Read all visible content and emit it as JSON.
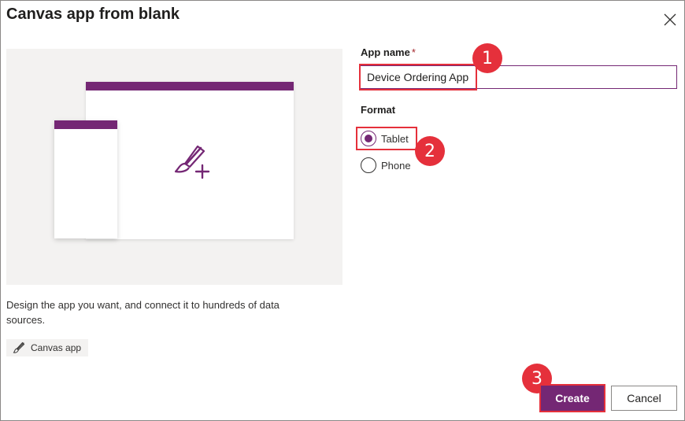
{
  "dialog": {
    "title": "Canvas app from blank",
    "close_icon": "close-icon"
  },
  "illustration": {
    "icon": "brush-plus-icon",
    "accent_color": "#742774"
  },
  "description": "Design the app you want, and connect it to hundreds of data sources.",
  "chip": {
    "icon": "paintbrush-icon",
    "label": "Canvas app"
  },
  "form": {
    "app_name_label": "App name",
    "required_marker": "*",
    "app_name_value": "Device Ordering App",
    "format_label": "Format",
    "format_options": [
      {
        "label": "Tablet",
        "selected": true
      },
      {
        "label": "Phone",
        "selected": false
      }
    ]
  },
  "callouts": [
    "1",
    "2",
    "3"
  ],
  "buttons": {
    "create": "Create",
    "cancel": "Cancel"
  },
  "colors": {
    "primary": "#742774",
    "highlight": "#e5303b"
  }
}
